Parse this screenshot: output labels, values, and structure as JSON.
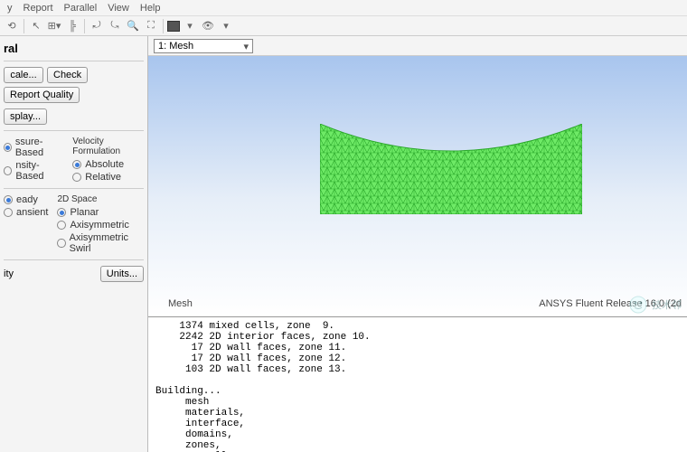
{
  "menu": {
    "items": [
      "y",
      "Report",
      "Parallel",
      "View",
      "Help"
    ]
  },
  "left": {
    "header": "ral",
    "buttons": {
      "scale": "cale...",
      "check": "Check",
      "report_quality": "Report Quality",
      "display": "splay..."
    },
    "solver_type": {
      "title": "",
      "options": [
        "ssure-Based",
        "nsity-Based"
      ],
      "selected": 0
    },
    "velocity_formulation": {
      "title": "Velocity Formulation",
      "options": [
        "Absolute",
        "Relative"
      ],
      "selected": 0
    },
    "time": {
      "title": "",
      "options": [
        "eady",
        "ansient"
      ],
      "selected": 0
    },
    "space": {
      "title": "2D Space",
      "options": [
        "Planar",
        "Axisymmetric",
        "Axisymmetric Swirl"
      ],
      "selected": 0
    },
    "units_row": {
      "label": "ity",
      "button": "Units..."
    }
  },
  "view": {
    "dropdown_label": "1: Mesh",
    "mesh_label": "Mesh",
    "release": "ANSYS Fluent Release 16.0 (2d"
  },
  "console_lines": [
    "    1374 mixed cells, zone  9.",
    "    2242 2D interior faces, zone 10.",
    "      17 2D wall faces, zone 11.",
    "      17 2D wall faces, zone 12.",
    "     103 2D wall faces, zone 13.",
    "",
    "Building...",
    "     mesh",
    "     materials,",
    "     interface,",
    "     domains,",
    "     zones,",
    "        wall"
  ],
  "watermark": "技术邻"
}
